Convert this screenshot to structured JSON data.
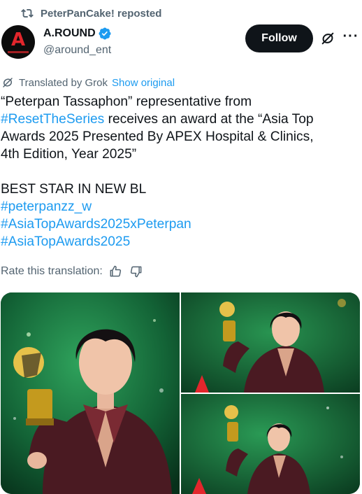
{
  "repost": {
    "icon": "repost-icon",
    "text": "PeterPanCake! reposted"
  },
  "author": {
    "avatar_text": "A",
    "name": "A.ROUND",
    "handle": "@around_ent",
    "verified_color": "#1d9bf0"
  },
  "actions": {
    "follow_label": "Follow",
    "grok_icon": "grok-icon",
    "more_icon": "more-icon",
    "more_glyph": "···"
  },
  "translation": {
    "label": "Translated by Grok",
    "show_original": "Show original",
    "rate_label": "Rate this translation:",
    "thumbs_up_icon": "thumbs-up-icon",
    "thumbs_down_icon": "thumbs-down-icon"
  },
  "post": {
    "line1": "“Peterpan Tassaphon” representative from",
    "line2_tag": "#ResetTheSeries",
    "line2_text": " receives an award at the “Asia Top",
    "line3": "Awards 2025 Presented By APEX Hospital & Clinics,",
    "line4": "4th Edition, Year 2025”",
    "line5": "BEST STAR IN NEW BL",
    "tag1": "#peterpanzz_w",
    "tag2": "#AsiaTopAwards2025xPeterpan",
    "tag3": "#AsiaTopAwards2025"
  },
  "colors": {
    "accent": "#1d9bf0",
    "text": "#0f1419",
    "muted": "#536471"
  }
}
